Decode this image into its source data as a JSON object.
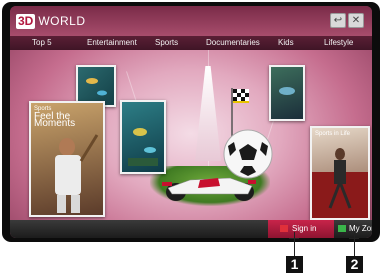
{
  "app": {
    "logo_badge": "3D",
    "logo_text": "WORLD"
  },
  "window_controls": {
    "back_glyph": "↩",
    "close_glyph": "✕",
    "back_icon": "back-icon",
    "close_icon": "close-icon"
  },
  "menu": {
    "items": [
      {
        "label": "Top 5"
      },
      {
        "label": "Entertainment"
      },
      {
        "label": "Sports"
      },
      {
        "label": "Documentaries"
      },
      {
        "label": "Kids"
      },
      {
        "label": "Lifestyle"
      }
    ]
  },
  "tiles": {
    "sports_feel": {
      "line1": "Sports",
      "line2": "Feel the Moments"
    },
    "sports_life": {
      "line1": "Sports in Life"
    }
  },
  "bottom": {
    "signin_label": "Sign in",
    "myzone_label": "My Zone",
    "signin_color": "#e0303a",
    "myzone_color": "#3ab54a"
  },
  "callouts": {
    "first": "1",
    "second": "2"
  }
}
